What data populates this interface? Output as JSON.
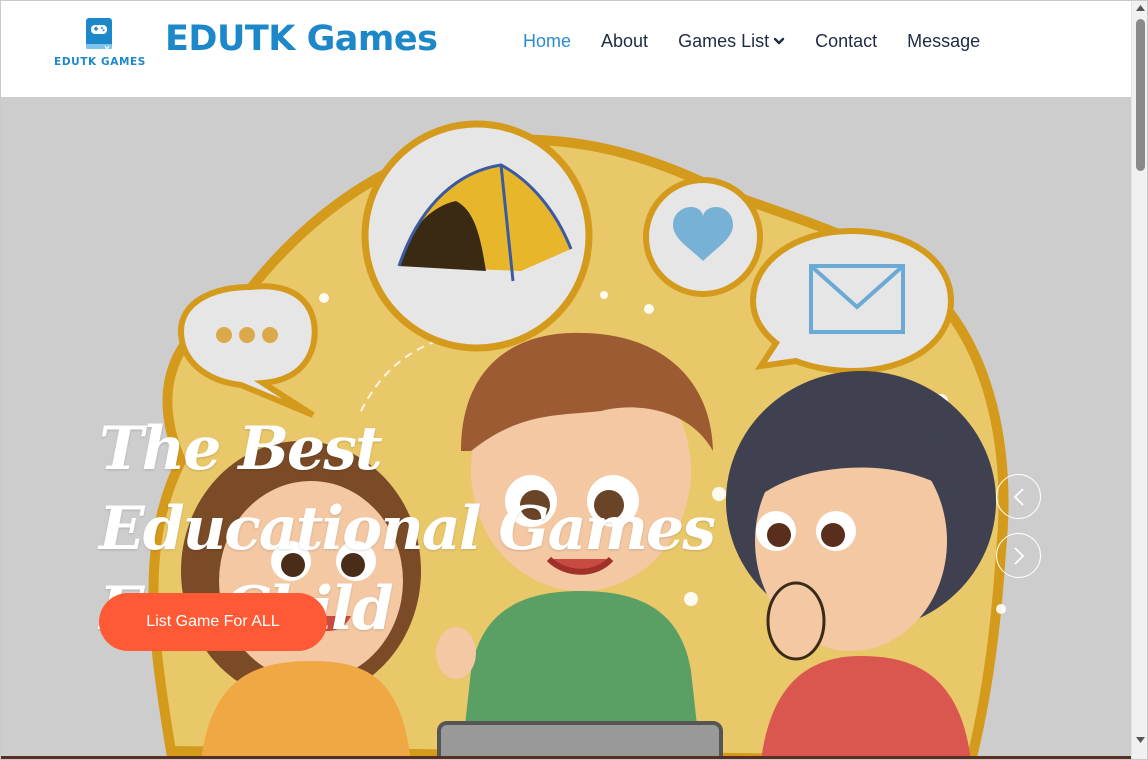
{
  "brand": {
    "logo_caption": "EDUTK GAMES",
    "title": "EDUTK Games",
    "accent_color": "#1c87c9"
  },
  "nav": {
    "items": [
      {
        "label": "Home",
        "active": true
      },
      {
        "label": "About",
        "active": false
      },
      {
        "label": "Games List",
        "active": false,
        "has_dropdown": true
      },
      {
        "label": "Contact",
        "active": false
      },
      {
        "label": "Message",
        "active": false
      }
    ]
  },
  "hero": {
    "heading": "The Best Educational Games For Child",
    "cta_label": "List Game For ALL",
    "cta_color": "#ff5a35",
    "prev_icon": "chevron-left-icon",
    "next_icon": "chevron-right-icon"
  }
}
